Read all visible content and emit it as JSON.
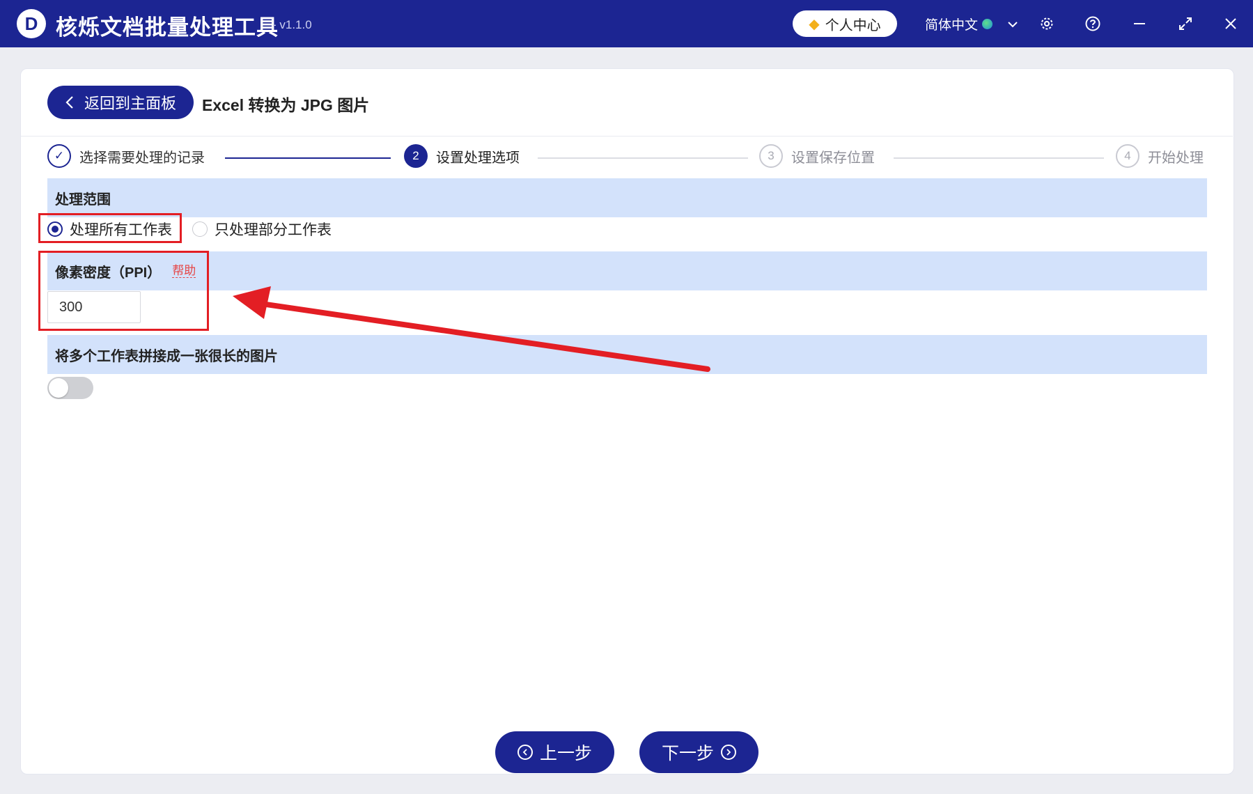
{
  "app": {
    "logo_letter": "D",
    "title": "核烁文档批量处理工具",
    "version": "- v1.1.0"
  },
  "titlebar": {
    "user_center_label": "个人中心",
    "language": "简体中文",
    "icons": [
      "diamond-icon",
      "globe-icon",
      "chevron-down-icon",
      "gear-icon",
      "help-icon",
      "minimize-icon",
      "maximize-icon",
      "close-icon"
    ]
  },
  "header": {
    "back_label": "返回到主面板",
    "page_title": "Excel 转换为 JPG 图片"
  },
  "steps": [
    {
      "number": "✓",
      "label": "选择需要处理的记录",
      "state": "done"
    },
    {
      "number": "2",
      "label": "设置处理选项",
      "state": "active"
    },
    {
      "number": "3",
      "label": "设置保存位置",
      "state": "pending"
    },
    {
      "number": "4",
      "label": "开始处理",
      "state": "pending"
    }
  ],
  "range": {
    "title": "处理范围",
    "options": [
      {
        "label": "处理所有工作表",
        "selected": true
      },
      {
        "label": "只处理部分工作表",
        "selected": false
      }
    ]
  },
  "ppi": {
    "title": "像素密度（PPI）",
    "help_label": "帮助",
    "value": "300"
  },
  "merge": {
    "title": "将多个工作表拼接成一张很长的图片",
    "enabled": false
  },
  "footer": {
    "prev_label": "上一步",
    "next_label": "下一步"
  },
  "colors": {
    "primary": "#1c2592",
    "section_bg": "#d3e2fb",
    "annotation": "#e31e24",
    "help_link": "#e64545"
  }
}
